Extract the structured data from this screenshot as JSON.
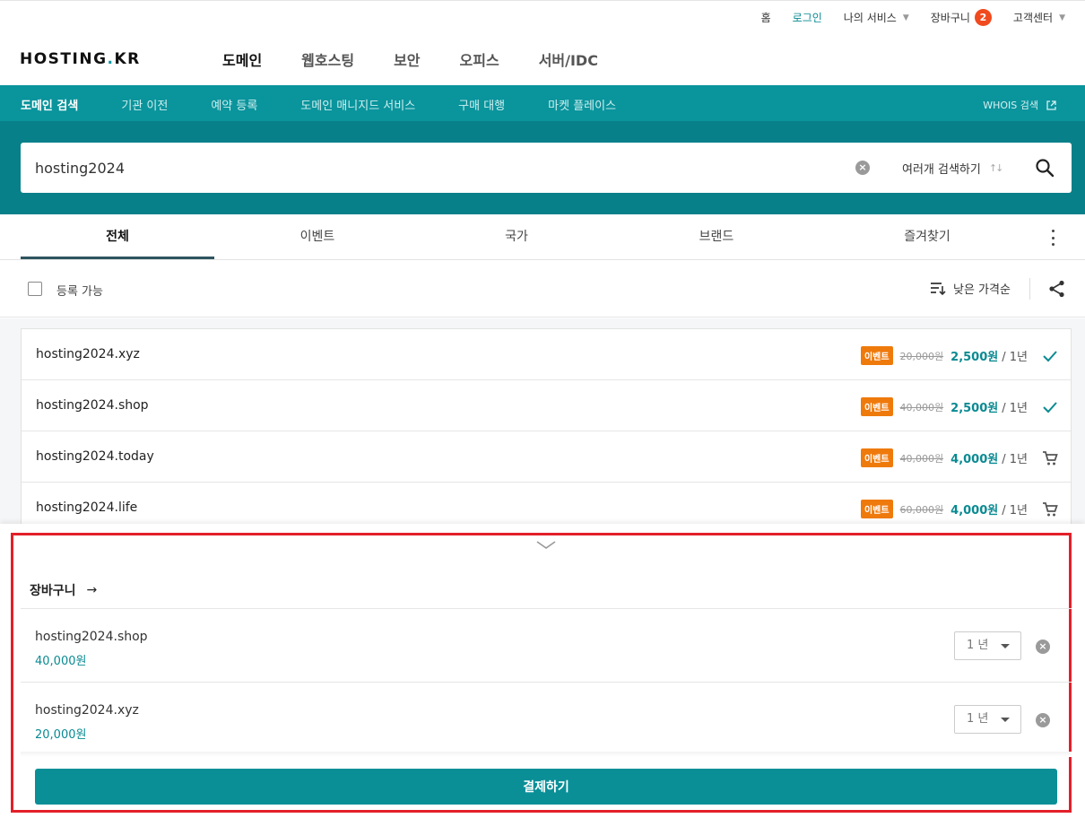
{
  "util": {
    "home": "홈",
    "login": "로그인",
    "my_service": "나의 서비스",
    "cart": "장바구니",
    "cart_count": "2",
    "support": "고객센터"
  },
  "logo": {
    "part1": "HOSTING",
    "part2": "KR"
  },
  "main_nav": [
    "도메인",
    "웹호스팅",
    "보안",
    "오피스",
    "서버/IDC"
  ],
  "sub_nav": [
    "도메인 검색",
    "기관 이전",
    "예약 등록",
    "도메인 매니지드 서비스",
    "구매 대행",
    "마켓 플레이스"
  ],
  "whois": "WHOIS 검색",
  "search": {
    "value": "hosting2024",
    "multi_label": "여러개 검색하기"
  },
  "tabs": [
    "전체",
    "이벤트",
    "국가",
    "브랜드",
    "즐겨찾기"
  ],
  "filter": {
    "available_label": "등록 가능",
    "sort_label": "낮은 가격순"
  },
  "results": [
    {
      "domain": "hosting2024.xyz",
      "badge": "이벤트",
      "original": "20,000원",
      "price": "2,500원",
      "period": "/ 1년",
      "status": "added"
    },
    {
      "domain": "hosting2024.shop",
      "badge": "이벤트",
      "original": "40,000원",
      "price": "2,500원",
      "period": "/ 1년",
      "status": "added"
    },
    {
      "domain": "hosting2024.today",
      "badge": "이벤트",
      "original": "40,000원",
      "price": "4,000원",
      "period": "/ 1년",
      "status": "cart"
    },
    {
      "domain": "hosting2024.life",
      "badge": "이벤트",
      "original": "60,000원",
      "price": "4,000원",
      "period": "/ 1년",
      "status": "cart"
    }
  ],
  "cart": {
    "title": "장바구니",
    "items": [
      {
        "domain": "hosting2024.shop",
        "price": "40,000원",
        "period": "1 년"
      },
      {
        "domain": "hosting2024.xyz",
        "price": "20,000원",
        "period": "1 년"
      }
    ],
    "checkout_label": "결제하기"
  },
  "colors": {
    "teal": "#0a949c",
    "teal_dark": "#08808a",
    "event": "#ef7a0c",
    "badge": "#f04a1e",
    "highlight": "#e3202a"
  }
}
